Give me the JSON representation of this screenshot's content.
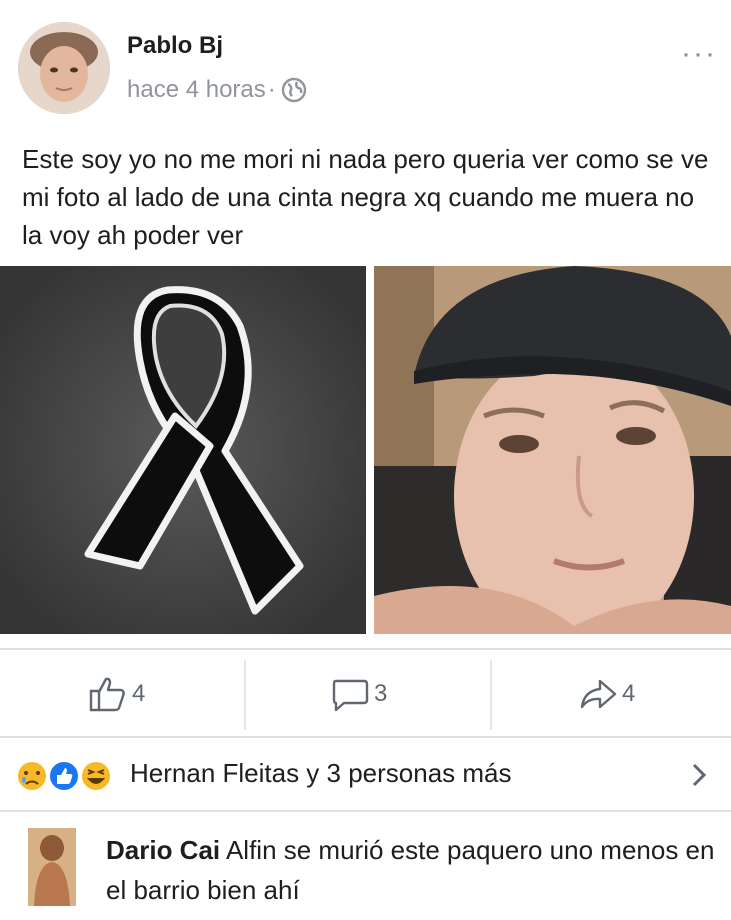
{
  "post": {
    "author": "Pablo Bj",
    "time": "hace 4 horas",
    "separator": "·",
    "more_label": "···",
    "text": "Este soy yo no me mori ni nada pero queria ver como se ve mi foto al lado de una cinta negra xq cuando me muera no la voy ah poder ver"
  },
  "actions": {
    "likes": "4",
    "comments": "3",
    "shares": "4"
  },
  "reactions": {
    "summary": "Hernan Fleitas y 3 personas más",
    "icons": [
      "sad-reaction-icon",
      "like-reaction-icon",
      "haha-reaction-icon"
    ]
  },
  "comment": {
    "author": "Dario Cai",
    "text": " Alfin se murió este paquero uno menos en el barrio bien ahí"
  },
  "colors": {
    "meta_gray": "#90949c",
    "action_gray": "#606770",
    "like_blue": "#1877f2",
    "reaction_yellow": "#f7b928"
  }
}
